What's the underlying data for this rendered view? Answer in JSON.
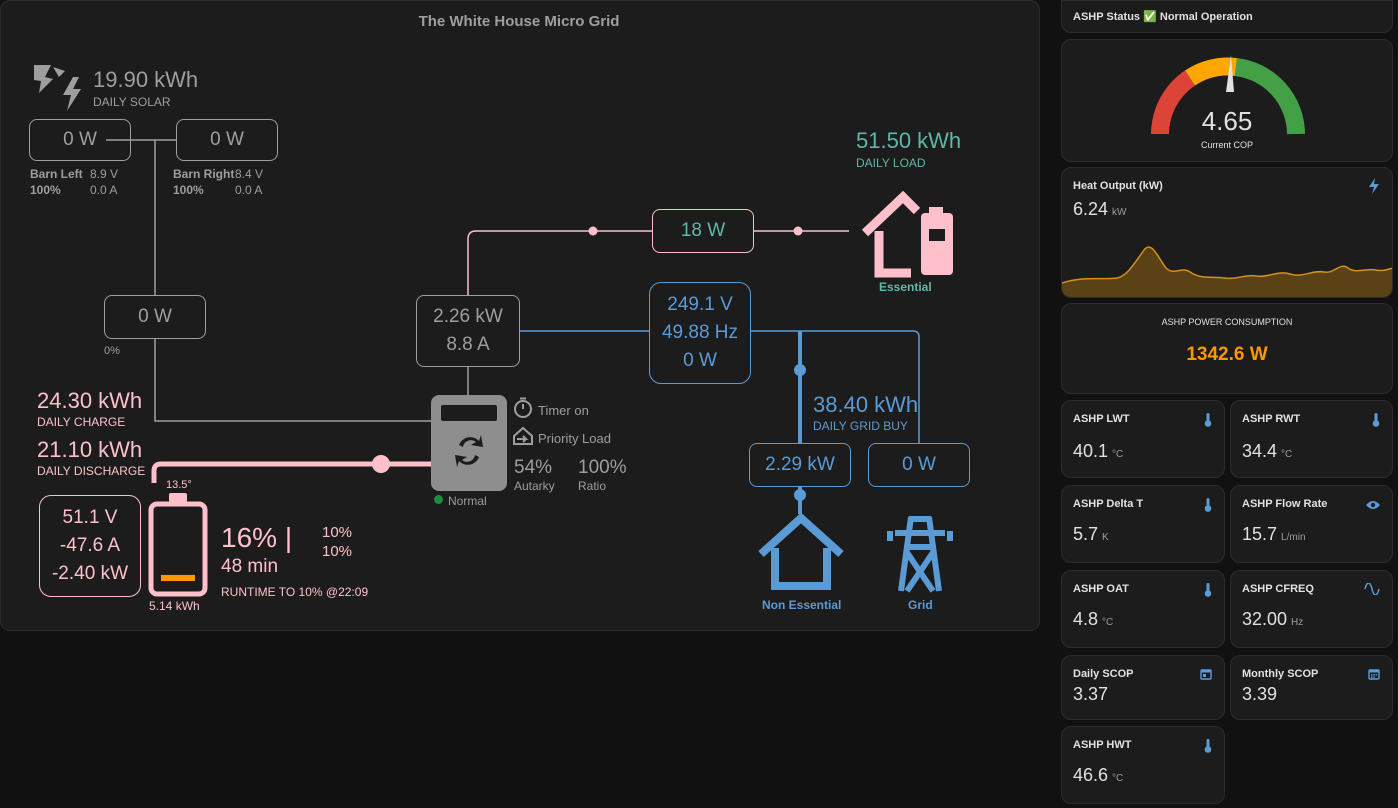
{
  "title": "The White House Micro Grid",
  "solar": {
    "daily_value": "19.90 kWh",
    "daily_label": "DAILY SOLAR",
    "left": {
      "power": "0 W",
      "name": "Barn Left",
      "voltage": "8.9 V",
      "pct": "100%",
      "current": "0.0 A"
    },
    "right": {
      "power": "0 W",
      "name": "Barn Right",
      "voltage": "8.4 V",
      "pct": "100%",
      "current": "0.0 A"
    },
    "total": {
      "power": "0 W",
      "pct": "0%"
    }
  },
  "battery": {
    "charge_value": "24.30 kWh",
    "charge_label": "DAILY CHARGE",
    "discharge_value": "21.10 kWh",
    "discharge_label": "DAILY DISCHARGE",
    "voltage": "51.1 V",
    "current": "-47.6 A",
    "power": "-2.40 kW",
    "temp": "13.5°",
    "capacity": "5.14 kWh",
    "soc": "16% |",
    "runtime": "48 min",
    "runtime_label": "RUNTIME TO 10% @22:09",
    "soc_min_a": "10%",
    "soc_min_b": "10%",
    "soc_fraction": 0.16
  },
  "inverter": {
    "power": "2.26 kW",
    "current": "8.8 A",
    "timer": "Timer on",
    "priority": "Priority Load",
    "autarky_value": "54%",
    "autarky_label": "Autarky",
    "ratio_value": "100%",
    "ratio_label": "Ratio",
    "status": "Normal"
  },
  "grid": {
    "voltage": "249.1 V",
    "frequency": "49.88 Hz",
    "power": "0 W",
    "daily_buy_value": "38.40 kWh",
    "daily_buy_label": "DAILY GRID BUY",
    "non_essential_power": "2.29 kW",
    "non_essential_label": "Non Essential",
    "grid_power": "0 W",
    "grid_label": "Grid"
  },
  "load": {
    "essential_power": "18 W",
    "daily_value": "51.50 kWh",
    "daily_label": "DAILY LOAD",
    "essential_label": "Essential"
  },
  "ashp": {
    "status_label": "ASHP Status",
    "status_icon": "✅",
    "status_value": "Normal Operation",
    "cop_value": "4.65",
    "cop_label": "Current COP",
    "heat_output_title": "Heat Output (kW)",
    "heat_output_value": "6.24",
    "heat_output_unit": "kW",
    "heat_output_icon": "flash-icon",
    "power_title": "ASHP POWER CONSUMPTION",
    "power_value": "1342.6 W",
    "power_color": "#ff9800",
    "tiles": [
      {
        "title": "ASHP LWT",
        "value": "40.1",
        "unit": "°C",
        "icon": "thermometer-icon"
      },
      {
        "title": "ASHP RWT",
        "value": "34.4",
        "unit": "°C",
        "icon": "thermometer-icon"
      },
      {
        "title": "ASHP Delta T",
        "value": "5.7",
        "unit": "K",
        "icon": "thermometer-icon"
      },
      {
        "title": "ASHP Flow Rate",
        "value": "15.7",
        "unit": "L/min",
        "icon": "eye-icon"
      },
      {
        "title": "ASHP OAT",
        "value": "4.8",
        "unit": "°C",
        "icon": "thermometer-icon"
      },
      {
        "title": "ASHP CFREQ",
        "value": "32.00",
        "unit": "Hz",
        "icon": "sine-wave-icon"
      },
      {
        "title": "Daily SCOP",
        "value": "3.37",
        "unit": "",
        "icon": "calendar-today-icon"
      },
      {
        "title": "Monthly SCOP",
        "value": "3.39",
        "unit": "",
        "icon": "calendar-month-icon"
      },
      {
        "title": "ASHP HWT",
        "value": "46.6",
        "unit": "°C",
        "icon": "thermometer-icon"
      }
    ]
  },
  "colors": {
    "solar": "#9e9e9e",
    "battery": "#ffc0cb",
    "grid": "#5b9bd5",
    "load": "#5fb8a6",
    "gauge_red": "#db4437",
    "gauge_orange": "#ffa600",
    "gauge_green": "#43a047"
  }
}
